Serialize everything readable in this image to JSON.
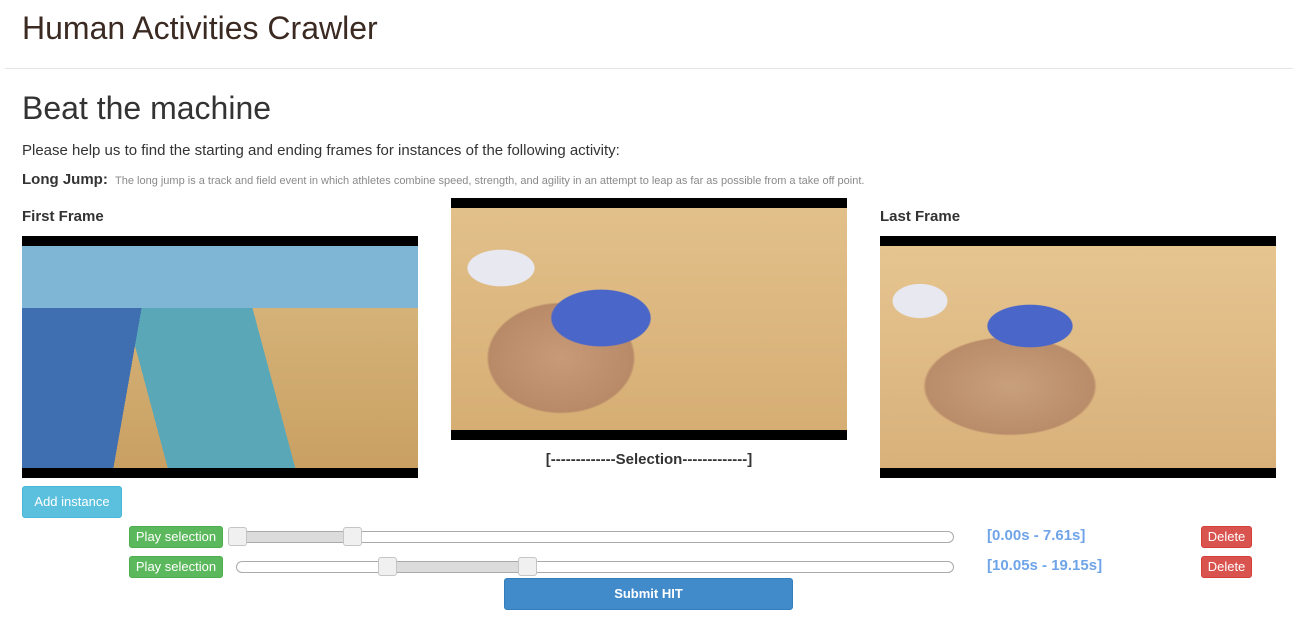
{
  "app": {
    "title": "Human Activities Crawler"
  },
  "page": {
    "heading": "Beat the machine",
    "intro": "Please help us to find the starting and ending frames for instances of the following activity:",
    "activity_name": "Long Jump:",
    "activity_description": "The long jump is a track and field event in which athletes combine speed, strength, and agility in an attempt to leap as far as possible from a take off point."
  },
  "frames": {
    "first_label": "First Frame",
    "last_label": "Last Frame",
    "selection_label": "[-------------Selection-------------]"
  },
  "buttons": {
    "add_instance": "Add instance",
    "submit": "Submit HIT"
  },
  "instances": [
    {
      "play_label": "Play selection",
      "delete_label": "Delete",
      "range_text": "[0.00s - 7.61s]",
      "start_fraction": 0.0,
      "end_fraction": 0.16
    },
    {
      "play_label": "Play selection",
      "delete_label": "Delete",
      "range_text": "[10.05s - 19.15s]",
      "start_fraction": 0.21,
      "end_fraction": 0.405
    }
  ],
  "colors": {
    "info": "#5bc0de",
    "success": "#5cb85c",
    "danger": "#d9534f",
    "primary": "#428bca",
    "time_text": "#6fa4e8"
  }
}
